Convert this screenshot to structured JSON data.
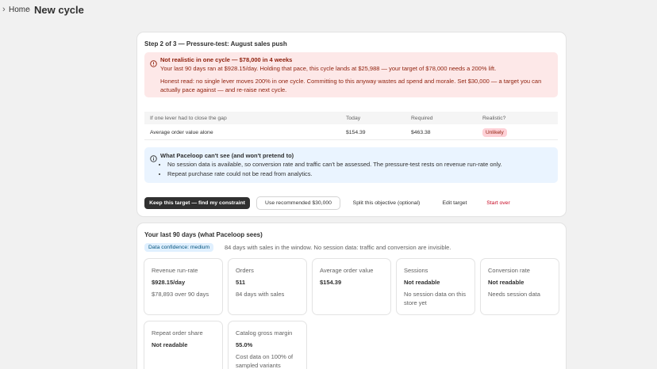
{
  "header": {
    "breadcrumb_home": "Home",
    "breadcrumb_sep": "›",
    "title": "New cycle"
  },
  "step": "Step 2 of 3 — Pressure-test: August sales push",
  "warning": {
    "heading": "Not realistic in one cycle — $78,000 in 4 weeks",
    "line1": "Your last 90 days ran at $928.15/day. Holding that pace, this cycle lands at $25,988 — your target of $78,000 needs a 200% lift.",
    "line2": "Honest read: no single lever moves 200% in one cycle. Committing to this anyway wastes ad spend and morale. Set $30,000 — a target you can actually pace against — and re-raise next cycle."
  },
  "table": {
    "headers": [
      "If one lever had to close the gap",
      "Today",
      "Required",
      "Realistic?"
    ],
    "rows": [
      {
        "lever": "Average order value alone",
        "today": "$154.39",
        "required": "$463.38",
        "realistic": "Unlikely"
      }
    ]
  },
  "info": {
    "heading": "What Paceloop can't see (and won't pretend to)",
    "bullets": [
      "No session data is available, so conversion rate and traffic can't be assessed. The pressure-test rests on revenue run-rate only.",
      "Repeat purchase rate could not be read from analytics."
    ]
  },
  "actions": {
    "keep": "Keep this target — find my constraint",
    "recommended": "Use recommended $30,000",
    "split": "Split this objective (optional)",
    "edit": "Edit target",
    "start_over": "Start over"
  },
  "summary": {
    "title": "Your last 90 days (what Paceloop sees)",
    "confidence": "Data confidence: medium",
    "confidence_text": "84 days with sales in the window. No session data: traffic and conversion are invisible.",
    "tiles": [
      {
        "label": "Revenue run-rate",
        "value": "$928.15/day",
        "sub": "$78,893 over 90 days"
      },
      {
        "label": "Orders",
        "value": "511",
        "sub": "84 days with sales"
      },
      {
        "label": "Average order value",
        "value": "$154.39",
        "sub": ""
      },
      {
        "label": "Sessions",
        "value": "Not readable",
        "sub": "No session data on this store yet"
      },
      {
        "label": "Conversion rate",
        "value": "Not readable",
        "sub": "Needs session data"
      },
      {
        "label": "Repeat order share",
        "value": "Not readable",
        "sub": ""
      },
      {
        "label": "Catalog gross margin",
        "value": "55.0%",
        "sub": "Cost data on 100% of sampled variants"
      }
    ]
  },
  "colors": {
    "critical_bg": "#fde8e8",
    "critical_text": "#8e1f0b",
    "info_bg": "#eaf4ff",
    "primary_button": "#303030",
    "destructive_link": "#c70a24"
  }
}
